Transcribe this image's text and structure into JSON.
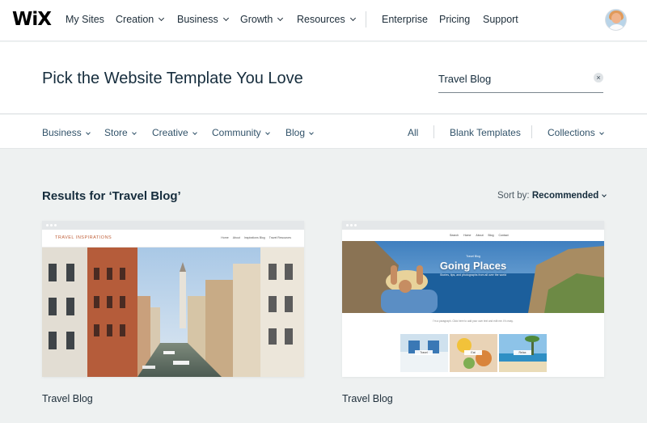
{
  "nav": {
    "logo": "WiX",
    "items": [
      "My Sites",
      "Creation",
      "Business",
      "Growth",
      "Resources",
      "Enterprise",
      "Pricing",
      "Support"
    ]
  },
  "header": {
    "title": "Pick the Website Template You Love",
    "search_value": "Travel Blog",
    "clear_icon": "×"
  },
  "categories": {
    "items": [
      "Business",
      "Store",
      "Creative",
      "Community",
      "Blog"
    ],
    "right": [
      "All",
      "Blank Templates",
      "Collections"
    ]
  },
  "results": {
    "title": "Results for ‘Travel Blog’",
    "sort_label": "Sort by:",
    "sort_value": "Recommended"
  },
  "templates": [
    {
      "name": "Travel Blog",
      "preview": {
        "logo": "TRAVEL INSPIRATIONS",
        "menu": [
          "Home",
          "About",
          "Inspirations Blog",
          "Travel Resources"
        ]
      }
    },
    {
      "name": "Travel Blog",
      "preview": {
        "menu": [
          "Search",
          "Home",
          "About",
          "Blog",
          "Contact"
        ],
        "kicker": "Travel Blog",
        "hero_title": "Going Places",
        "hero_sub": "Stories, tips, and photographs from all over the world",
        "intro": "I'm a paragraph. Click here to add your own text and edit me. It's easy.",
        "thumbs": [
          "Travel",
          "Eat",
          "Relax"
        ]
      }
    }
  ],
  "colors": {
    "accent_text": "#162d3d",
    "page_bg": "#eef1f1",
    "card_bar": "#e4e7e9"
  }
}
